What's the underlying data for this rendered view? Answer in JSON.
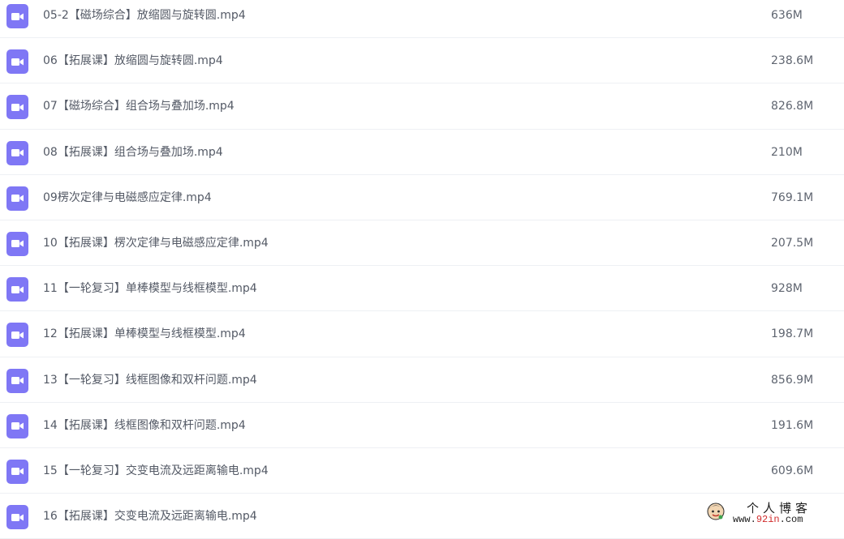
{
  "files": [
    {
      "name": "05-2【磁场综合】放缩圆与旋转圆.mp4",
      "size": "636M",
      "icon": "video-file-icon"
    },
    {
      "name": "06【拓展课】放缩圆与旋转圆.mp4",
      "size": "238.6M",
      "icon": "video-file-icon"
    },
    {
      "name": "07【磁场综合】组合场与叠加场.mp4",
      "size": "826.8M",
      "icon": "video-file-icon"
    },
    {
      "name": "08【拓展课】组合场与叠加场.mp4",
      "size": "210M",
      "icon": "video-file-icon"
    },
    {
      "name": "09楞次定律与电磁感应定律.mp4",
      "size": "769.1M",
      "icon": "video-file-icon"
    },
    {
      "name": "10【拓展课】楞次定律与电磁感应定律.mp4",
      "size": "207.5M",
      "icon": "video-file-icon"
    },
    {
      "name": "11【一轮复习】单棒模型与线框模型.mp4",
      "size": "928M",
      "icon": "video-file-icon"
    },
    {
      "name": "12【拓展课】单棒模型与线框模型.mp4",
      "size": "198.7M",
      "icon": "video-file-icon"
    },
    {
      "name": "13【一轮复习】线框图像和双杆问题.mp4",
      "size": "856.9M",
      "icon": "video-file-icon"
    },
    {
      "name": "14【拓展课】线框图像和双杆问题.mp4",
      "size": "191.6M",
      "icon": "video-file-icon"
    },
    {
      "name": "15【一轮复习】交变电流及远距离输电.mp4",
      "size": "609.6M",
      "icon": "video-file-icon"
    },
    {
      "name": "16【拓展课】交变电流及远距离输电.mp4",
      "size": "",
      "icon": "video-file-icon"
    }
  ],
  "watermark": {
    "title": "个人博客",
    "url_prefix": "www.",
    "url_accent": "92in",
    "url_suffix": ".com"
  },
  "colors": {
    "icon_bg": "#7f77f5",
    "row_divider": "#eef0f4",
    "text": "#545a66",
    "watermark_accent": "#d12a2a"
  }
}
